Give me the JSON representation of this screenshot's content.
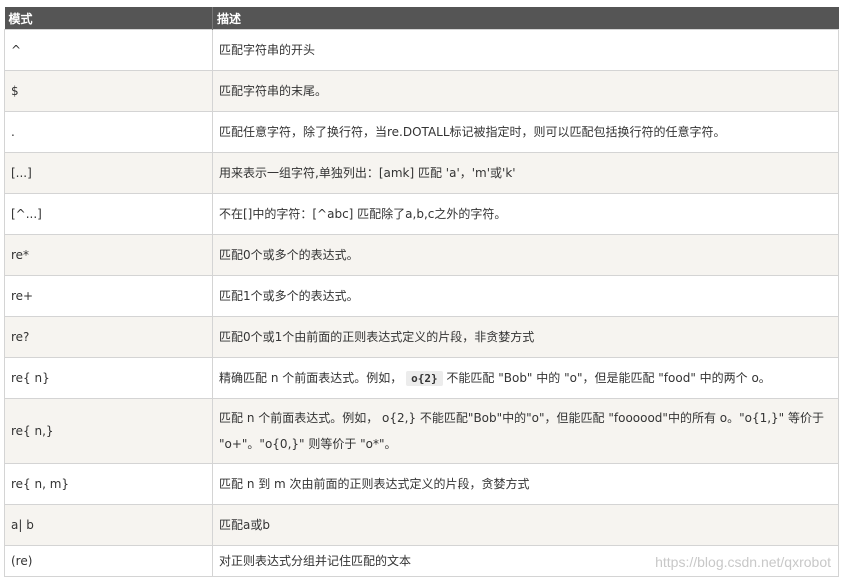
{
  "header": {
    "pattern": "模式",
    "description": "描述"
  },
  "rows": [
    {
      "pattern": "^",
      "description": "匹配字符串的开头"
    },
    {
      "pattern": "$",
      "description": "匹配字符串的末尾。"
    },
    {
      "pattern": ".",
      "description": "匹配任意字符，除了换行符，当re.DOTALL标记被指定时，则可以匹配包括换行符的任意字符。"
    },
    {
      "pattern": "[...]",
      "description": "用来表示一组字符,单独列出：[amk] 匹配 'a'，'m'或'k'"
    },
    {
      "pattern": "[^...]",
      "description": "不在[]中的字符：[^abc] 匹配除了a,b,c之外的字符。"
    },
    {
      "pattern": "re*",
      "description": "匹配0个或多个的表达式。"
    },
    {
      "pattern": "re+",
      "description": "匹配1个或多个的表达式。"
    },
    {
      "pattern": "re?",
      "description": "匹配0个或1个由前面的正则表达式定义的片段，非贪婪方式"
    },
    {
      "pattern": "re{ n}",
      "description_before": "精确匹配 n 个前面表达式。例如，",
      "code": "o{2}",
      "description_after": "不能匹配 \"Bob\" 中的 \"o\"，但是能匹配 \"food\" 中的两个 o。"
    },
    {
      "pattern": "re{ n,}",
      "description": "匹配 n 个前面表达式。例如， o{2,} 不能匹配\"Bob\"中的\"o\"，但能匹配 \"foooood\"中的所有 o。\"o{1,}\" 等价于 \"o+\"。\"o{0,}\" 则等价于 \"o*\"。"
    },
    {
      "pattern": "re{ n, m}",
      "description": "匹配 n 到 m 次由前面的正则表达式定义的片段，贪婪方式"
    },
    {
      "pattern": "a| b",
      "description": "匹配a或b"
    },
    {
      "pattern": "(re)",
      "description": "对正则表达式分组并记住匹配的文本"
    }
  ],
  "watermark": "https://blog.csdn.net/qxrobot"
}
